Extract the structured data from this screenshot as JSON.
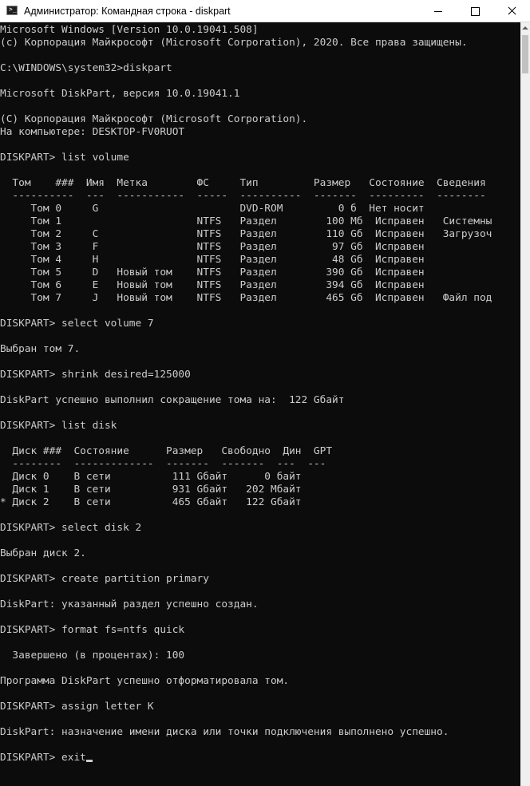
{
  "window": {
    "title": "Администратор: Командная строка - diskpart",
    "icon_text": ">_"
  },
  "console": {
    "lines": [
      "Microsoft Windows [Version 10.0.19041.508]",
      "(c) Корпорация Майкрософт (Microsoft Corporation), 2020. Все права защищены.",
      "",
      "C:\\WINDOWS\\system32>diskpart",
      "",
      "Microsoft DiskPart, версия 10.0.19041.1",
      "",
      "(С) Корпорация Майкрософт (Microsoft Corporation).",
      "На компьютере: DESKTOP-FV0RUOT",
      "",
      "DISKPART> list volume",
      "",
      "  Том    ###  Имя  Метка        ФС     Тип         Размер   Состояние  Сведения",
      "  ----------  ---  -----------  -----  ----------  -------  ---------  --------",
      "     Том 0     G                       DVD-ROM         0 б  Нет носит",
      "     Том 1                      NTFS   Раздел        100 Мб  Исправен   Системны",
      "     Том 2     C                NTFS   Раздел        110 Gб  Исправен   Загрузоч",
      "     Том 3     F                NTFS   Раздел         97 Gб  Исправен",
      "     Том 4     H                NTFS   Раздел         48 Gб  Исправен",
      "     Том 5     D   Новый том    NTFS   Раздел        390 Gб  Исправен",
      "     Том 6     E   Новый том    NTFS   Раздел        394 Gб  Исправен",
      "     Том 7     J   Новый том    NTFS   Раздел        465 Gб  Исправен   Файл под",
      "",
      "DISKPART> select volume 7",
      "",
      "Выбран том 7.",
      "",
      "DISKPART> shrink desired=125000",
      "",
      "DiskPart успешно выполнил сокращение тома на:  122 Gбайт",
      "",
      "DISKPART> list disk",
      "",
      "  Диск ###  Состояние      Размер   Свободно  Дин  GPT",
      "  --------  -------------  -------  -------  ---  ---",
      "  Диск 0    В сети          111 Gбайт      0 байт",
      "  Диск 1    В сети          931 Gбайт   202 Мбайт",
      "* Диск 2    В сети          465 Gбайт   122 Gбайт",
      "",
      "DISKPART> select disk 2",
      "",
      "Выбран диск 2.",
      "",
      "DISKPART> create partition primary",
      "",
      "DiskPart: указанный раздел успешно создан.",
      "",
      "DISKPART> format fs=ntfs quick",
      "",
      "  Завершено (в процентах): 100",
      "",
      "Программа DiskPart успешно отформатировала том.",
      "",
      "DISKPART> assign letter K",
      "",
      "DiskPart: назначение имени диска или точки подключения выполнено успешно.",
      "",
      "DISKPART> exit"
    ]
  },
  "icons": {
    "minimize": "minimize-icon",
    "maximize": "maximize-icon",
    "close": "close-icon"
  },
  "colors": {
    "console_bg": "#0c0c0c",
    "console_text": "#cccccc",
    "titlebar_bg": "#ffffff"
  }
}
